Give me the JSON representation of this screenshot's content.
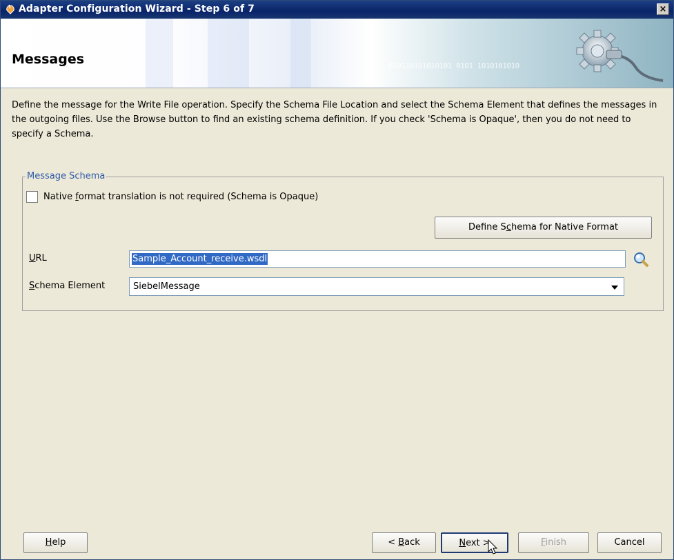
{
  "window": {
    "title": "Adapter Configuration Wizard - Step 6 of 7",
    "close_label": "×"
  },
  "banner": {
    "heading": "Messages",
    "binary": "010110101010101 0101 1010101010"
  },
  "description": "Define the message for the Write File operation.  Specify the Schema File Location and select the Schema Element that defines the messages in the outgoing files. Use the Browse button to find an existing schema definition. If you check 'Schema is Opaque', then you do not need to specify a Schema.",
  "message_schema": {
    "legend": "Message Schema",
    "opaque_checkbox": {
      "checked": false,
      "label_pre": "Native ",
      "label_accel": "f",
      "label_post": "ormat translation is not required (Schema is Opaque)"
    },
    "define_button": {
      "pre": "Define S",
      "accel": "c",
      "post": "hema for Native Format"
    },
    "url": {
      "label_accel": "U",
      "label_post": "RL",
      "value": "Sample_Account_receive.wsdl"
    },
    "schema_element": {
      "label_accel": "S",
      "label_post": "chema Element",
      "value": "SiebelMessage"
    }
  },
  "footer": {
    "help": {
      "accel": "H",
      "post": "elp"
    },
    "back": {
      "pre": "< ",
      "accel": "B",
      "post": "ack"
    },
    "next": {
      "accel": "N",
      "post": "ext >"
    },
    "finish": {
      "accel": "F",
      "post": "inish"
    },
    "cancel": "Cancel"
  },
  "colors": {
    "titlebar": "#0a246a",
    "legend": "#2f5aa8",
    "selection": "#316ac5"
  },
  "icons": [
    "app-icon",
    "close-icon",
    "gear-plug-icon",
    "magnifier-icon",
    "chevron-down-icon",
    "mouse-cursor-icon"
  ]
}
